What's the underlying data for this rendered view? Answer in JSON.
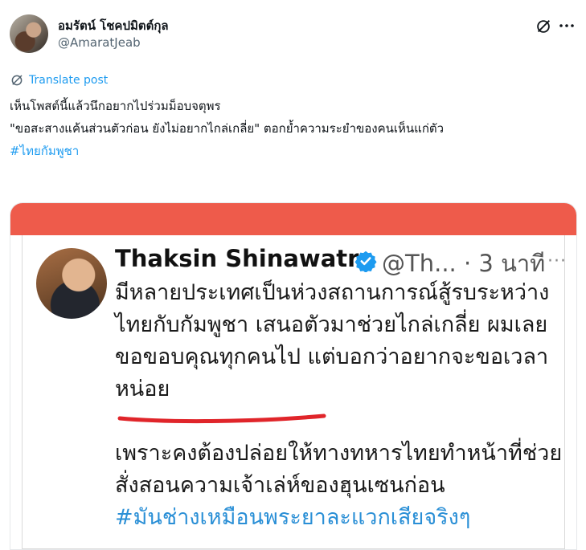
{
  "author": {
    "display_name": "อมรัตน์ โชคปมิตต์กุล",
    "handle": "@AmaratJeab"
  },
  "icons": {
    "grok": "grok-icon",
    "more": "more-icon",
    "translate": "translate-icon",
    "verified": "verified-badge-icon"
  },
  "translate_label": "Translate post",
  "post": {
    "line1": "เห็นโพสต์นี้แล้วนึกอยากไปร่วมม็อบจตุพร",
    "line2": "\"ขอสะสางแค้นส่วนตัวก่อน ยังไม่อยากไกล่เกลี่ย\" ตอกย้ำความระยำของคนเห็นแก่ตัว",
    "hashtag": "#ไทยกัมพูชา"
  },
  "media": {
    "name": "Thaksin Shinawatra",
    "handle_time": "@Th... · 3 นาที",
    "more": "···",
    "para1": "มีหลายประเทศเป็นห่วงสถานการณ์สู้รบระหว่างไทยกับกัมพูชา เสนอตัวมาช่วยไกล่เกลี่ย ผมเลยขอขอบคุณทุกคนไป แต่บอกว่าอยากจะขอเวลาหน่อย",
    "para2": "เพราะคงต้องปล่อยให้ทางทหารไทยทำหน้าที่ช่วยสั่งสอนความเจ้าเล่ห์ของฮุนเซนก่อน",
    "hashtag": "#มันช่างเหมือนพระยาละแวกเสียจริงๆ"
  },
  "colors": {
    "link": "#1d9bf0",
    "media_top_bar": "#ee5b4b",
    "underline": "#e0252a"
  }
}
